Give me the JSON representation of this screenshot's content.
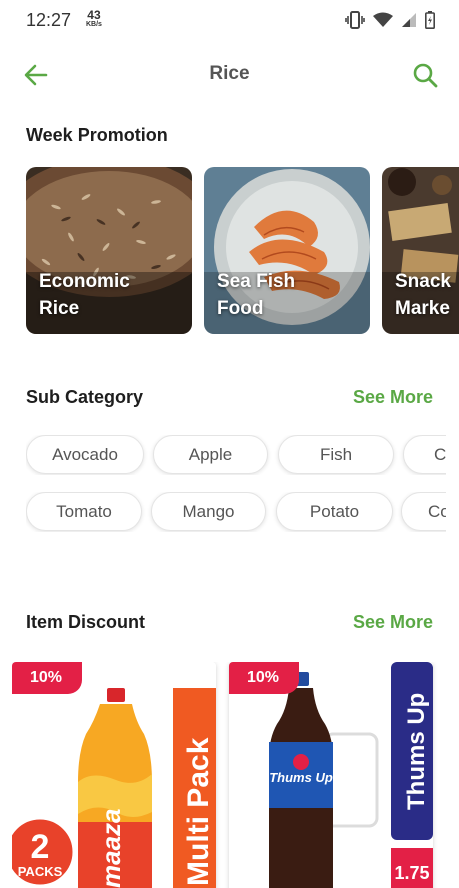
{
  "status_bar": {
    "time": "12:27",
    "speed_value": "43",
    "speed_unit": "KB/s",
    "icons": [
      "vibrate-icon",
      "wifi-icon",
      "signal-icon",
      "battery-icon"
    ]
  },
  "app_bar": {
    "title": "Rice",
    "back_icon": "arrow-left-icon",
    "search_icon": "search-icon",
    "accent_color": "#5aa845"
  },
  "week_promotion": {
    "title": "Week Promotion",
    "items": [
      {
        "label": "Economic\nRice"
      },
      {
        "label": "Sea Fish\nFood"
      },
      {
        "label": "Snack\nMarke"
      }
    ]
  },
  "sub_category": {
    "title": "Sub Category",
    "see_more": "See More",
    "row1": [
      "Avocado",
      "Apple",
      "Fish",
      "C"
    ],
    "row2": [
      "Tomato",
      "Mango",
      "Potato",
      "Co"
    ]
  },
  "item_discount": {
    "title": "Item Discount",
    "see_more": "See More",
    "products": [
      {
        "discount": "10%",
        "brand": "maaza",
        "side_banner": "Multi Pack",
        "pack_number": "2",
        "pack_label": "PACKS"
      },
      {
        "discount": "10%",
        "brand": "Thums Up",
        "side_banner": "Thums Up",
        "size": "1.75"
      }
    ]
  },
  "colors": {
    "accent": "#5aa845",
    "discount_badge": "#e32046"
  }
}
